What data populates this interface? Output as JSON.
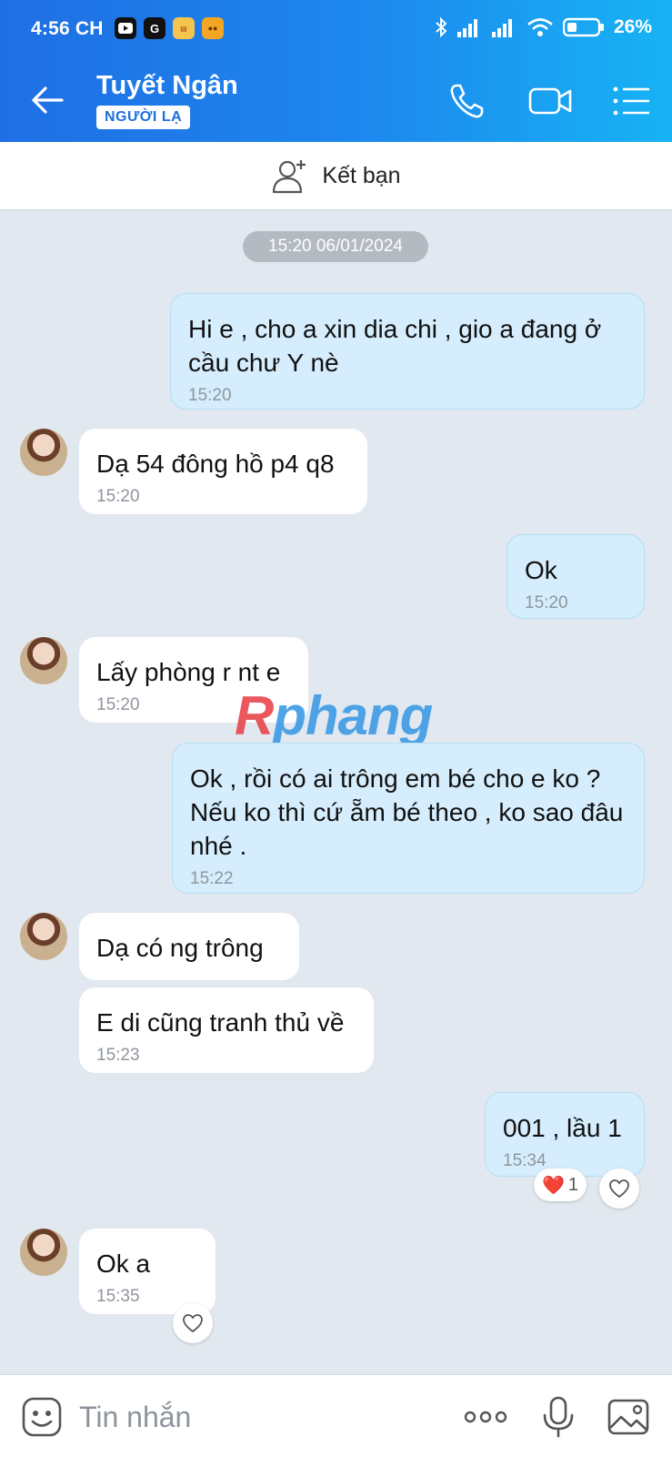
{
  "status_bar": {
    "time": "4:56 CH",
    "battery": "26%"
  },
  "header": {
    "contact_name": "Tuyết Ngân",
    "badge": "NGƯỜI LẠ",
    "icons": [
      "back-arrow-icon",
      "phone-icon",
      "video-call-icon",
      "menu-list-icon"
    ]
  },
  "friend_bar": {
    "label": "Kết bạn"
  },
  "date_separator": "15:20 06/01/2024",
  "messages": [
    {
      "dir": "out",
      "text": "Hi e , cho a xin dia chi , gio a đang ở cầu chư Y nè",
      "time": "15:20"
    },
    {
      "dir": "in",
      "text": "Dạ 54 đông hồ p4 q8",
      "time": "15:20"
    },
    {
      "dir": "out",
      "text": "Ok",
      "time": "15:20"
    },
    {
      "dir": "in",
      "text": "Lấy phòng r nt e",
      "time": "15:20"
    },
    {
      "dir": "out",
      "text": "Ok , rồi có ai trông em bé cho e ko ? Nếu ko thì cứ ẵm bé theo , ko sao đâu nhé .",
      "time": "15:22"
    },
    {
      "dir": "in",
      "text": "Dạ có ng trông",
      "time": ""
    },
    {
      "dir": "in",
      "text": "E di cũng tranh thủ về",
      "time": "15:23"
    },
    {
      "dir": "out",
      "text": "001 , lầu 1",
      "time": "15:34",
      "reaction": {
        "emoji": "❤️",
        "count": "1"
      }
    },
    {
      "dir": "in",
      "text": "Ok a",
      "time": "15:35"
    }
  ],
  "watermark": "Rphang",
  "composer": {
    "placeholder": "Tin nhắn"
  },
  "colors": {
    "header_start": "#1f6fe3",
    "header_end": "#17b3f4",
    "outgoing_bubble": "#d5edfc",
    "incoming_bubble": "#ffffff",
    "chat_background": "#e2e8ef"
  }
}
